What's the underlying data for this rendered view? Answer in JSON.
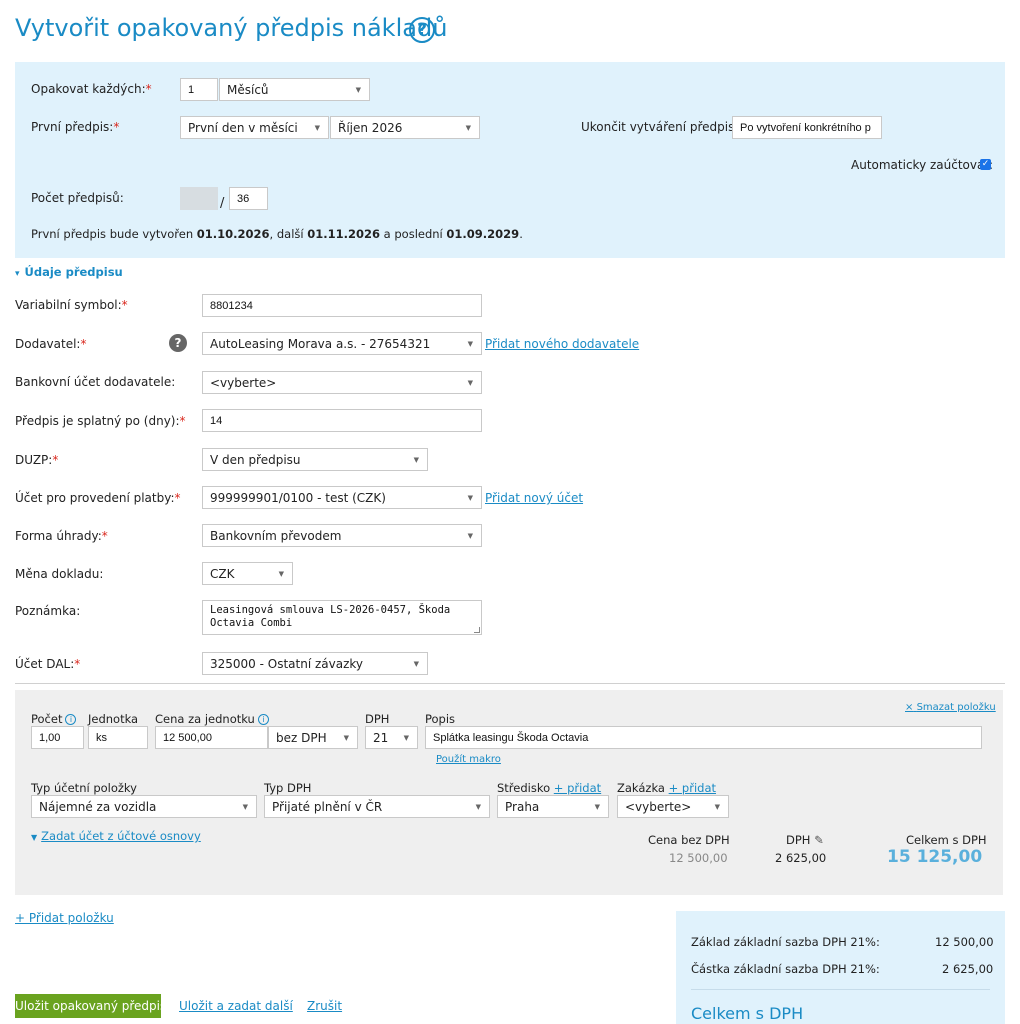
{
  "page": {
    "title": "Vytvořit opakovaný předpis nákladů",
    "help": "?"
  },
  "recurrence": {
    "repeat_label": "Opakovat každých:",
    "repeat_value": "1",
    "repeat_unit": "Měsíců",
    "first_label": "První předpis:",
    "first_day": "První den v měsíci",
    "first_month": "Říjen 2026",
    "end_label": "Ukončit vytváření předpisů:",
    "end_value": "Po vytvoření konkrétního p",
    "auto_label": "Automaticky zaúčtovat:",
    "auto_checked": true,
    "count_label": "Počet předpisů:",
    "count_separator": "/",
    "count_total": "36",
    "summary_pre": "První předpis bude vytvořen ",
    "summary_first": "01.10.2026",
    "summary_mid": ", další ",
    "summary_next": "01.11.2026",
    "summary_mid2": " a poslední ",
    "summary_last": "01.09.2029",
    "summary_end": "."
  },
  "section": {
    "title": "Údaje předpisu",
    "toggle": "▾"
  },
  "form": {
    "vs_label": "Variabilní symbol:",
    "vs_value": "8801234",
    "supplier_label": "Dodavatel:",
    "supplier_value": "AutoLeasing Morava a.s. - 27654321",
    "supplier_add": "Přidat nového dodavatele",
    "bank_label": "Bankovní účet dodavatele:",
    "bank_value": "<vyberte>",
    "due_label": "Předpis je splatný po (dny):",
    "due_value": "14",
    "duzp_label": "DUZP:",
    "duzp_value": "V den předpisu",
    "account_label": "Účet pro provedení platby:",
    "account_value": "999999901/0100 - test (CZK)",
    "account_add": "Přidat nový účet",
    "payment_label": "Forma úhrady:",
    "payment_value": "Bankovním převodem",
    "currency_label": "Měna dokladu:",
    "currency_value": "CZK",
    "note_label": "Poznámka:",
    "note_value": "Leasingová smlouva LS-2026-0457, Škoda Octavia Combi",
    "dal_label": "Účet DAL:",
    "dal_value": "325000 - Ostatní závazky"
  },
  "item": {
    "delete": "Smazat položku",
    "delete_icon": "×",
    "count_label": "Počet",
    "count_value": "1,00",
    "unit_label": "Jednotka",
    "unit_value": "ks",
    "price_label": "Cena za jednotku",
    "price_value": "12 500,00",
    "price_mode": "bez DPH",
    "vat_label": "DPH",
    "vat_value": "21",
    "desc_label": "Popis",
    "desc_value": "Splátka leasingu Škoda Octavia",
    "macro": "Použít makro",
    "type_label": "Typ účetní položky",
    "type_value": "Nájemné za vozidla",
    "vat_type_label": "Typ DPH",
    "vat_type_value": "Přijaté plnění v ČR",
    "center_label": "Středisko",
    "center_add": "+ přidat",
    "center_value": "Praha",
    "order_label": "Zakázka",
    "order_add": "+ přidat",
    "order_value": "<vyberte>",
    "chart_link": "Zadat účet z účtové osnovy",
    "net_label": "Cena bez DPH",
    "net_value": "12 500,00",
    "vat_sum_label": "DPH",
    "vat_sum_value": "2 625,00",
    "total_label": "Celkem s DPH",
    "total_value": "15 125,00"
  },
  "footer": {
    "add_item": "+ Přidat položku",
    "save": "Uložit opakovaný předpis",
    "save_next": "Uložit a zadat další",
    "cancel": "Zrušit"
  },
  "summary": {
    "base_label": "Základ základní sazba DPH 21%:",
    "base_value": "12 500,00",
    "vat_label": "Částka základní sazba DPH 21%:",
    "vat_value": "2 625,00",
    "total_label": "Celkem s DPH"
  },
  "colors": {
    "accent": "#1a8bc5",
    "panel": "#e0f2fc",
    "primary_button": "#6aa31f",
    "required": "#d9261c"
  }
}
